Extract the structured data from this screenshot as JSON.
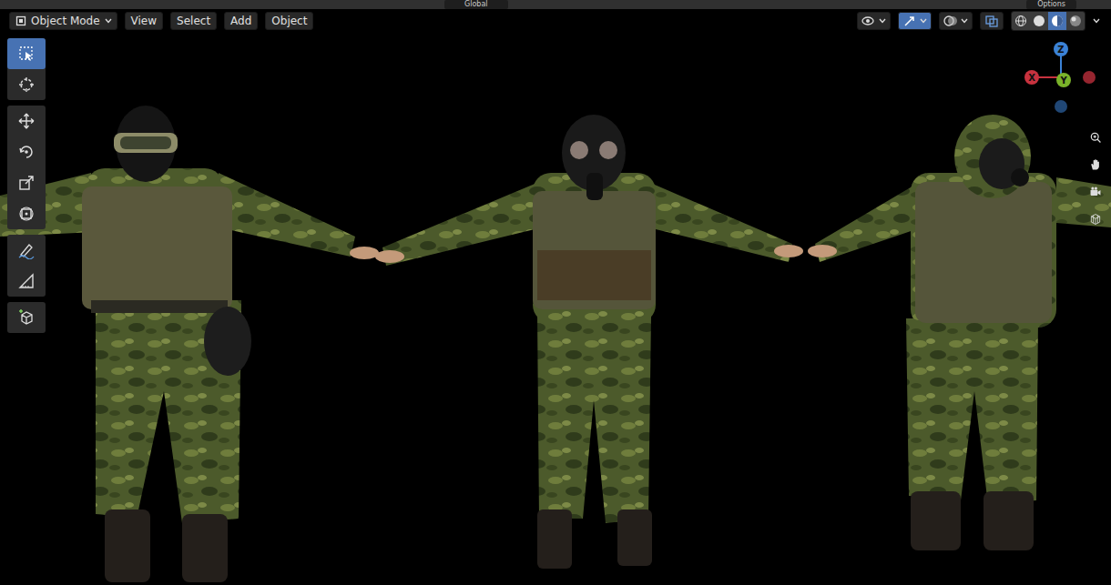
{
  "top_bar": {
    "orientation": "Global",
    "options": "Options"
  },
  "header": {
    "mode": "Object Mode",
    "menus": [
      "View",
      "Select",
      "Add",
      "Object"
    ],
    "toggles": [
      {
        "kind": "visibility",
        "selected": false
      },
      {
        "kind": "gizmos",
        "selected": true
      },
      {
        "kind": "overlays",
        "selected": false
      },
      {
        "kind": "xray",
        "selected": false
      }
    ],
    "shading": [
      {
        "kind": "wireframe",
        "selected": false
      },
      {
        "kind": "solid",
        "selected": false
      },
      {
        "kind": "material",
        "selected": true
      },
      {
        "kind": "rendered",
        "selected": false
      }
    ]
  },
  "toolbar": {
    "groups": [
      {
        "tools": [
          {
            "kind": "select-box",
            "selected": true
          },
          {
            "kind": "cursor",
            "selected": false
          }
        ]
      },
      {
        "tools": [
          {
            "kind": "move",
            "selected": false
          },
          {
            "kind": "rotate",
            "selected": false
          },
          {
            "kind": "scale",
            "selected": false
          },
          {
            "kind": "transform",
            "selected": false
          }
        ]
      },
      {
        "tools": [
          {
            "kind": "annotate",
            "selected": false
          },
          {
            "kind": "measure",
            "selected": false
          }
        ]
      },
      {
        "tools": [
          {
            "kind": "add-cube",
            "selected": false
          }
        ]
      }
    ]
  },
  "gizmo": {
    "axes": [
      {
        "label": "X",
        "color": "#c8323f"
      },
      {
        "label": "Y",
        "color": "#7ab32a"
      },
      {
        "label": "Z",
        "color": "#3b82d6"
      }
    ]
  },
  "nav_buttons": [
    {
      "kind": "zoom"
    },
    {
      "kind": "pan"
    },
    {
      "kind": "camera"
    },
    {
      "kind": "ortho"
    }
  ]
}
